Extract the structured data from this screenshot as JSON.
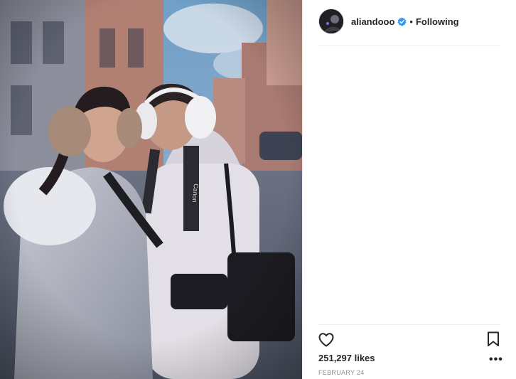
{
  "post": {
    "username": "aliandooo",
    "separator": "•",
    "follow_status": "Following",
    "likes_text": "251,297 likes",
    "date": "FEBRUARY 24",
    "more_label": "•••"
  },
  "icons": {
    "verified": "verified-badge-icon",
    "like": "heart-icon",
    "save": "bookmark-icon",
    "options": "more-options-icon"
  },
  "photo": {
    "strap_text": "Canon"
  },
  "colors": {
    "verified_blue": "#3897f0",
    "text": "#262626",
    "muted": "#8e8e8e"
  }
}
